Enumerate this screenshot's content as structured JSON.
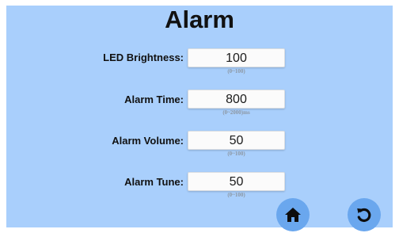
{
  "screen": {
    "title": "Alarm",
    "colors": {
      "background": "#a9cffc",
      "button": "#6aa7ee",
      "field": "#fbfbfb",
      "range_text": "#8c97a3"
    }
  },
  "settings": [
    {
      "label": "LED Brightness:",
      "value": "100",
      "range": "(0~100)"
    },
    {
      "label": "Alarm Time:",
      "value": "800",
      "range": "(0~2000)ms"
    },
    {
      "label": "Alarm Volume:",
      "value": "50",
      "range": "(0~100)"
    },
    {
      "label": "Alarm Tune:",
      "value": "50",
      "range": "(0~100)"
    }
  ],
  "nav": {
    "home_icon": "home-icon",
    "back_icon": "undo-icon"
  }
}
